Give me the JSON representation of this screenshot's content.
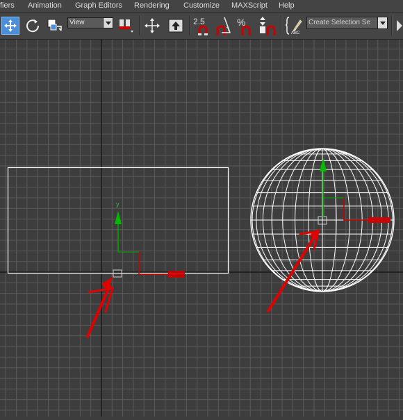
{
  "menubar": {
    "items": [
      "fiers",
      "Animation",
      "Graph Editors",
      "Rendering",
      "Customize",
      "MAXScript",
      "Help"
    ]
  },
  "toolbar": {
    "reference_coord": "View",
    "angle_snap_value": "2.5",
    "percent_snap_symbol": "%",
    "named_selection_placeholder": "Create Selection Se",
    "icons": [
      "select-move-icon",
      "select-rotate-icon",
      "select-scale-icon",
      "view-dropdown",
      "pivot-icon",
      "manipulate-icon",
      "keyboard-shortcut-icon",
      "snap-icon",
      "angle-snap-icon",
      "percent-snap-icon",
      "spinner-snap-icon",
      "edit-named-selection-icon"
    ]
  },
  "viewport": {
    "background": "#3d3d3d",
    "grid_color": "#5a5a5a",
    "axis_color": "#1a1a1a",
    "wireframe_color": "#ffffff",
    "gizmo_x_color": "#cc0000",
    "gizmo_y_color": "#00aa00",
    "annotation_color": "#e00000",
    "gizmo_y_label": "y",
    "objects": [
      "plane-object",
      "sphere-object"
    ]
  }
}
